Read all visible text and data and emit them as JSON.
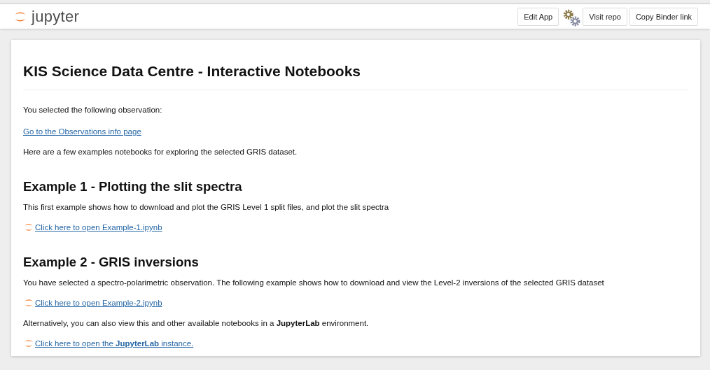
{
  "header": {
    "logo": "jupyter",
    "buttons": [
      {
        "label": "Edit App"
      },
      {
        "label": "Visit repo"
      },
      {
        "label": "Copy Binder link"
      }
    ]
  },
  "content": [
    {
      "kind": "title",
      "text": "KIS Science Data Centre - Interactive Notebooks"
    },
    {
      "kind": "paragraph",
      "text": "You selected the following observation:"
    },
    {
      "kind": "link",
      "text": "Go to the Observations info page"
    },
    {
      "kind": "paragraph",
      "text": "Here are a few examples notebooks for exploring the selected GRIS dataset."
    },
    {
      "kind": "heading",
      "text": "Example 1 - Plotting the slit spectra"
    },
    {
      "kind": "paragraph",
      "text": "This first example shows how to download and plot the GRIS Level 1 split files, and plot the slit spectra"
    },
    {
      "kind": "notebook-link",
      "text": "Click here to open Example-1.ipynb"
    },
    {
      "kind": "heading",
      "text": "Example 2 - GRIS inversions"
    },
    {
      "kind": "paragraph",
      "text": "You have selected a spectro-polarimetric observation. The following example shows how to download and view the Level-2 inversions of the selected GRIS dataset"
    },
    {
      "kind": "notebook-link",
      "text": "Click here to open Example-2.ipynb"
    },
    {
      "kind": "paragraph",
      "text": "Alternatively, you can also view this and other available notebooks in a **JupyterLab** environment."
    },
    {
      "kind": "notebook-link",
      "text": "Click here to open the **JupyterLab** instance."
    }
  ]
}
